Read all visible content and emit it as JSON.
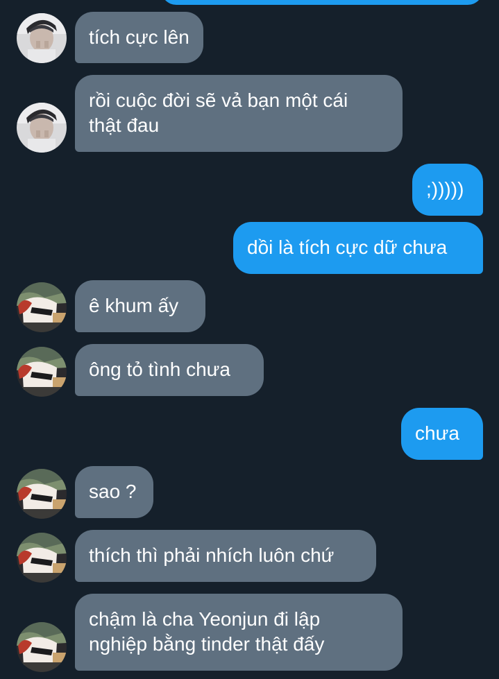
{
  "conversation": {
    "messages": [
      {
        "sender": "contact",
        "avatar": "avatar-girl-photo",
        "text": "tích cực lên"
      },
      {
        "sender": "contact",
        "avatar": "avatar-girl-photo",
        "text": "rồi cuộc đời sẽ vả bạn một cái\nthật đau"
      },
      {
        "sender": "self",
        "text": ";)))))"
      },
      {
        "sender": "self",
        "text": "dồi là tích cực dữ chưa"
      },
      {
        "sender": "contact",
        "avatar": "avatar-anime",
        "text": "ê khum ấy"
      },
      {
        "sender": "contact",
        "avatar": "avatar-anime",
        "text": "ông tỏ tình chưa"
      },
      {
        "sender": "self",
        "text": "chưa"
      },
      {
        "sender": "contact",
        "avatar": "avatar-anime",
        "text": "sao ?"
      },
      {
        "sender": "contact",
        "avatar": "avatar-anime",
        "text": "thích thì phải nhích luôn chứ"
      },
      {
        "sender": "contact",
        "avatar": "avatar-anime",
        "text": "chậm là cha Yeonjun đi lập\nnghiệp bằng tinder thật đấy"
      }
    ]
  },
  "colors": {
    "background": "#15202b",
    "incoming_bubble": "#5f7080",
    "outgoing_bubble": "#1d9bf0",
    "text": "#ffffff"
  }
}
